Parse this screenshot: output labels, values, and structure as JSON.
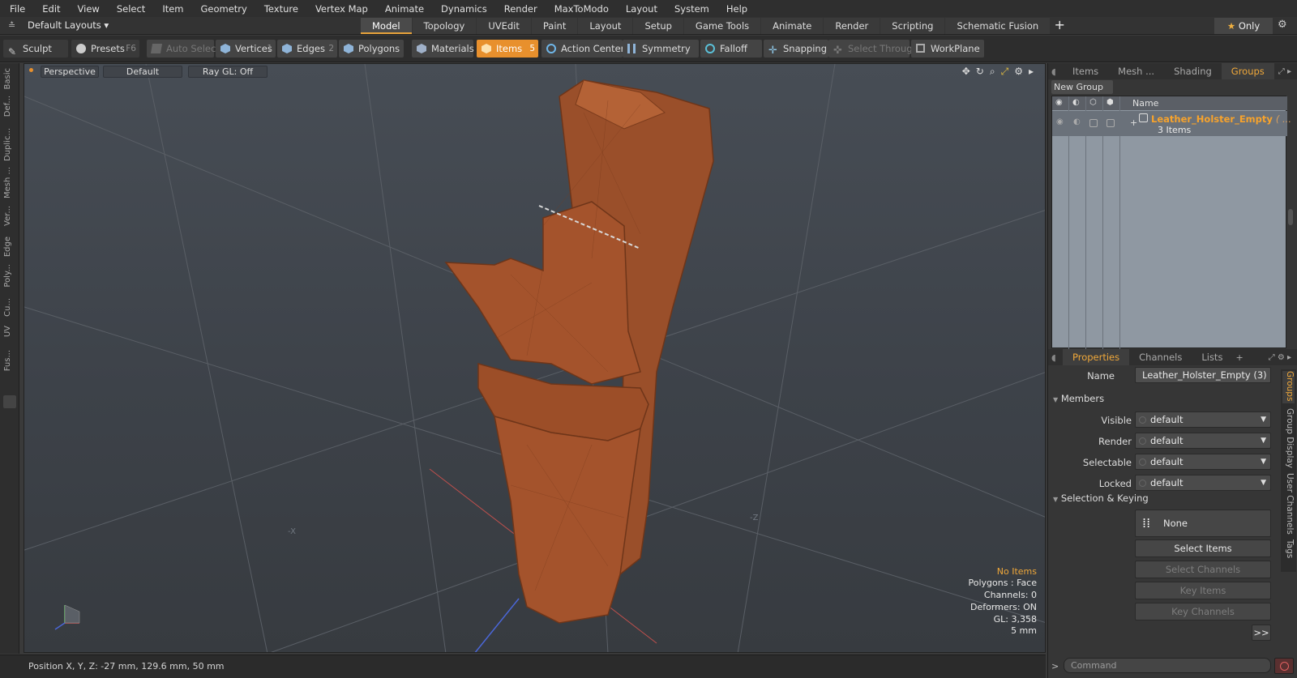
{
  "menu": [
    "File",
    "Edit",
    "View",
    "Select",
    "Item",
    "Geometry",
    "Texture",
    "Vertex Map",
    "Animate",
    "Dynamics",
    "Render",
    "MaxToModo",
    "Layout",
    "System",
    "Help"
  ],
  "layouts_label": "Default Layouts",
  "tabs": [
    "Model",
    "Topology",
    "UVEdit",
    "Paint",
    "Layout",
    "Setup",
    "Game Tools",
    "Animate",
    "Render",
    "Scripting",
    "Schematic Fusion"
  ],
  "only_label": "Only",
  "toolbar": {
    "sculpt": "Sculpt",
    "presets": "Presets",
    "presets_key": "F6",
    "auto_select": "Auto Select",
    "vertices": "Vertices",
    "vertices_key": "1",
    "edges": "Edges",
    "edges_key": "2",
    "polygons": "Polygons",
    "materials": "Materials",
    "items": "Items",
    "items_key": "5",
    "action_center": "Action Center",
    "symmetry": "Symmetry",
    "falloff": "Falloff",
    "snapping": "Snapping",
    "select_through": "Select Through",
    "workplane": "WorkPlane"
  },
  "left_tabs": [
    "Basic",
    "Def...",
    "Duplic...",
    "Mesh ...",
    "Ver...",
    "Edge",
    "Poly...",
    "Cu...",
    "UV",
    "Fus..."
  ],
  "viewport": {
    "perspective": "Perspective",
    "default": "Default",
    "raygl": "Ray GL: Off",
    "axis_minus_x": "-X",
    "axis_minus_z": "-Z"
  },
  "stats": {
    "no_items": "No Items",
    "polygons": "Polygons : Face",
    "channels": "Channels: 0",
    "deformers": "Deformers: ON",
    "gl": "GL: 3,358",
    "units": "5 mm"
  },
  "status": "Position X, Y, Z:  -27 mm, 129.6 mm, 50 mm",
  "top_panel": {
    "tabs": [
      "Items",
      "Mesh ...",
      "Shading",
      "Groups"
    ],
    "new_group": "New Group",
    "col_name": "Name",
    "group_name": "Leather_Holster_Empty",
    "group_suffix": "( ...",
    "group_count": "3 Items"
  },
  "props": {
    "tabs": [
      "Properties",
      "Channels",
      "Lists"
    ],
    "name_label": "Name",
    "name_value": "Leather_Holster_Empty (3)",
    "members": "Members",
    "visible_label": "Visible",
    "visible": "default",
    "render_label": "Render",
    "render": "default",
    "selectable_label": "Selectable",
    "selectable": "default",
    "locked_label": "Locked",
    "locked": "default",
    "sel_keying": "Selection & Keying",
    "none": "None",
    "select_items": "Select Items",
    "select_channels": "Select Channels",
    "key_items": "Key Items",
    "key_channels": "Key Channels",
    "more": ">>"
  },
  "side_tabs": [
    "Groups",
    "Group Display",
    "User Channels",
    "Tags"
  ],
  "command_placeholder": "Command",
  "colors": {
    "accent": "#e8902d",
    "group_name": "#f7a32c",
    "leather": "#a4532c"
  }
}
